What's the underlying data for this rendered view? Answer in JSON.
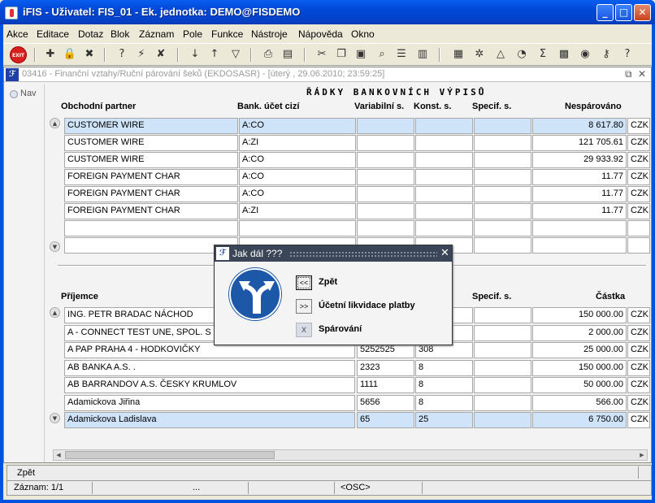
{
  "window": {
    "title": "iFIS - Uživatel: FIS_01 - Ek. jednotka: DEMO@FISDEMO",
    "minimize": "_",
    "maximize": "□",
    "close": "✕"
  },
  "menu": [
    "Akce",
    "Editace",
    "Dotaz",
    "Blok",
    "Záznam",
    "Pole",
    "Funkce",
    "Nástroje",
    "Nápověda",
    "Okno"
  ],
  "toolbar": {
    "exit_label": "EXIT",
    "icons": [
      "insert-record-icon",
      "lock-record-icon",
      "delete-record-icon",
      "enter-query-icon",
      "execute-query-icon",
      "cancel-query-icon",
      "sort-asc-icon",
      "sort-desc-icon",
      "filter-icon",
      "print-icon",
      "print-preview-icon",
      "cut-icon",
      "copy-icon",
      "paste-icon",
      "search-icon",
      "list-icon",
      "columns-icon",
      "calculator-icon",
      "settings-icon",
      "navigation-icon",
      "clock-icon",
      "sum-icon",
      "excel-icon",
      "export-icon",
      "help-key-icon",
      "help-icon"
    ]
  },
  "form": {
    "title": "03416 - Finanční vztahy/Ruční párování šeků (EKDOSASR) - [úterý  , 29.06.2010; 23:59:25]",
    "nav_label": "Nav",
    "section_title": "ŘÁDKY BANKOVNÍCH VÝPISŮ",
    "upper_headers": {
      "partner": "Obchodní partner",
      "account": "Bank. účet cizí",
      "var": "Variabilní s.",
      "konst": "Konst. s.",
      "spec": "Specif. s.",
      "amount": "Nespárováno"
    },
    "upper_rows": [
      {
        "partner": "CUSTOMER WIRE",
        "account": "A:CO",
        "var": "",
        "konst": "",
        "spec": "",
        "amount": "8 617.80",
        "cur": "CZK"
      },
      {
        "partner": "CUSTOMER WIRE",
        "account": "A:ZI",
        "var": "",
        "konst": "",
        "spec": "",
        "amount": "121 705.61",
        "cur": "CZK"
      },
      {
        "partner": "CUSTOMER WIRE",
        "account": "A:CO",
        "var": "",
        "konst": "",
        "spec": "",
        "amount": "29 933.92",
        "cur": "CZK"
      },
      {
        "partner": "FOREIGN PAYMENT CHAR",
        "account": "A:CO",
        "var": "",
        "konst": "",
        "spec": "",
        "amount": "11.77",
        "cur": "CZK"
      },
      {
        "partner": "FOREIGN PAYMENT CHAR",
        "account": "A:CO",
        "var": "",
        "konst": "",
        "spec": "",
        "amount": "11.77",
        "cur": "CZK"
      },
      {
        "partner": "FOREIGN PAYMENT CHAR",
        "account": "A:ZI",
        "var": "",
        "konst": "",
        "spec": "",
        "amount": "11.77",
        "cur": "CZK"
      },
      {
        "partner": "",
        "account": "",
        "var": "",
        "konst": "",
        "spec": "",
        "amount": "",
        "cur": ""
      },
      {
        "partner": "",
        "account": "",
        "var": "",
        "konst": "",
        "spec": "",
        "amount": "",
        "cur": ""
      }
    ],
    "lower_headers": {
      "recipient": "Příjemce",
      "spec": "Specif. s.",
      "amount": "Částka"
    },
    "lower_rows": [
      {
        "recipient": "ING. PETR BRADAC NÁCHOD",
        "var": "",
        "konst": "",
        "spec": "",
        "amount": "150 000.00",
        "cur": "CZK"
      },
      {
        "recipient": "A - CONNECT TEST UNE, SPOL. S R. O.",
        "var": "",
        "konst": "",
        "spec": "",
        "amount": "2 000.00",
        "cur": "CZK"
      },
      {
        "recipient": "A PAP PRAHA 4 - HODKOVIČKY",
        "var": "5252525",
        "konst": "308",
        "spec": "",
        "amount": "25 000.00",
        "cur": "CZK"
      },
      {
        "recipient": "AB BANKA A.S. .",
        "var": "2323",
        "konst": "8",
        "spec": "",
        "amount": "150 000.00",
        "cur": "CZK"
      },
      {
        "recipient": "AB BARRANDOV A.S. ČESKY KRUMLOV",
        "var": "1111",
        "konst": "8",
        "spec": "",
        "amount": "50 000.00",
        "cur": "CZK"
      },
      {
        "recipient": "Adamickova Jiřina",
        "var": "5656",
        "konst": "8",
        "spec": "",
        "amount": "566.00",
        "cur": "CZK"
      },
      {
        "recipient": "Adamickova Ladislava",
        "var": "65",
        "konst": "25",
        "spec": "",
        "amount": "6 750.00",
        "cur": "CZK"
      }
    ]
  },
  "dialog": {
    "title": "Jak dál ???",
    "close": "✕",
    "options": [
      {
        "btn": "<<",
        "label": "Zpět"
      },
      {
        "btn": ">>",
        "label": "Účetní likvidace platby"
      },
      {
        "btn": "X",
        "label": "Spárování"
      }
    ]
  },
  "status": {
    "message": "Zpět",
    "record": "Záznam: 1/1",
    "dots": "...",
    "mode": "<OSC>"
  }
}
